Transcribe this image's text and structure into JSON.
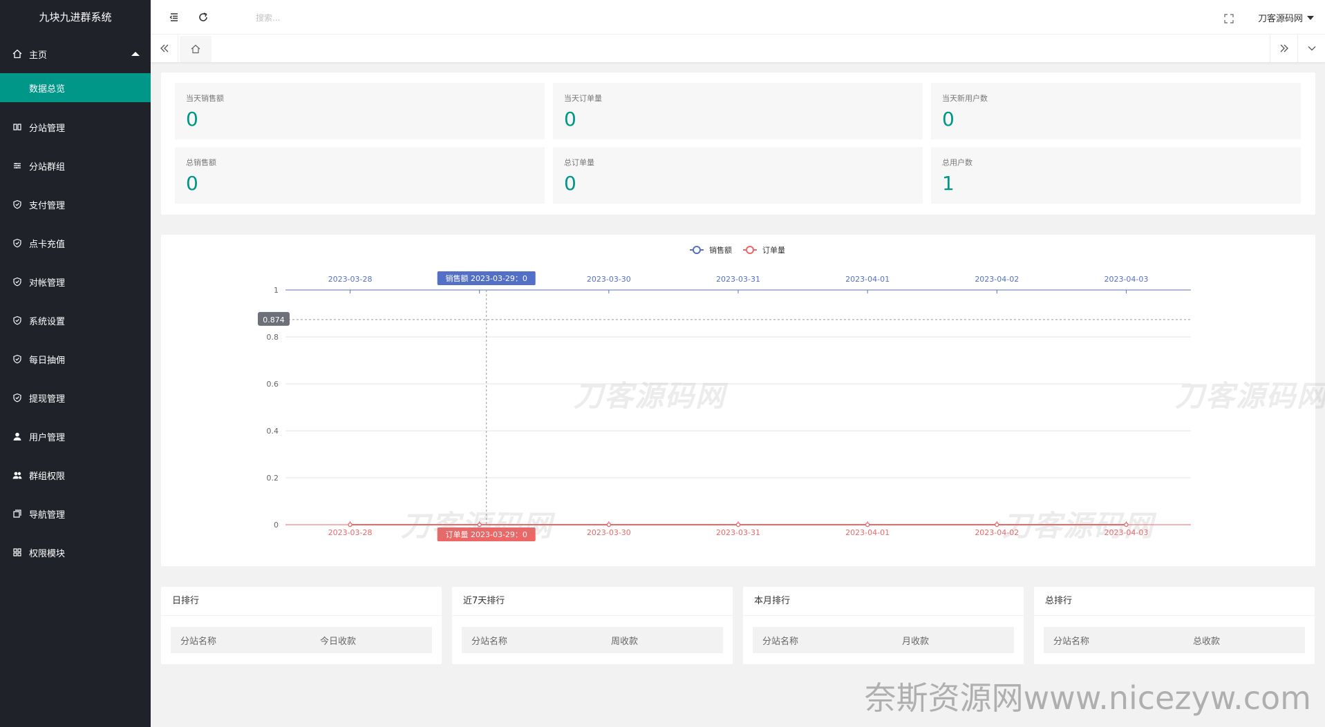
{
  "app": {
    "title": "九块九进群系统"
  },
  "sidebar": {
    "home": {
      "label": "主页",
      "icon": "home-icon"
    },
    "home_sub": {
      "label": "数据总览"
    },
    "items": [
      {
        "label": "分站管理",
        "icon": "columns-icon"
      },
      {
        "label": "分站群组",
        "icon": "sliders-icon"
      },
      {
        "label": "支付管理",
        "icon": "shield-icon"
      },
      {
        "label": "点卡充值",
        "icon": "shield-icon"
      },
      {
        "label": "对帐管理",
        "icon": "shield-icon"
      },
      {
        "label": "系统设置",
        "icon": "shield-icon"
      },
      {
        "label": "每日抽佣",
        "icon": "shield-icon"
      },
      {
        "label": "提现管理",
        "icon": "shield-icon"
      },
      {
        "label": "用户管理",
        "icon": "user-icon"
      },
      {
        "label": "群组权限",
        "icon": "users-icon"
      },
      {
        "label": "导航管理",
        "icon": "nav-icon"
      },
      {
        "label": "权限模块",
        "icon": "modules-icon"
      }
    ]
  },
  "header": {
    "search_placeholder": "搜索...",
    "user_name": "刀客源码网"
  },
  "stats": [
    {
      "label": "当天销售额",
      "value": "0"
    },
    {
      "label": "当天订单量",
      "value": "0"
    },
    {
      "label": "当天新用户数",
      "value": "0"
    },
    {
      "label": "总销售额",
      "value": "0"
    },
    {
      "label": "总订单量",
      "value": "0"
    },
    {
      "label": "总用户数",
      "value": "1"
    }
  ],
  "chart_data": {
    "type": "line",
    "x": [
      "2023-03-28",
      "2023-03-29",
      "2023-03-30",
      "2023-03-31",
      "2023-04-01",
      "2023-04-02",
      "2023-04-03"
    ],
    "series": [
      {
        "name": "销售额",
        "values": [
          0,
          0,
          0,
          0,
          0,
          0,
          0
        ],
        "color": "#5470c6"
      },
      {
        "name": "订单量",
        "values": [
          0,
          0,
          0,
          0,
          0,
          0,
          0
        ],
        "color": "#ee6666"
      }
    ],
    "ylim": [
      0,
      1
    ],
    "yticks": [
      "0",
      "0.2",
      "0.4",
      "0.6",
      "0.8",
      "1"
    ],
    "legend_position": "top-center",
    "grid": true,
    "tooltip": {
      "top_label": "销售额  2023-03-29：0",
      "bottom_label": "订单量  2023-03-29：0",
      "cursor_value": "0.874"
    }
  },
  "rankings": [
    {
      "title": "日排行",
      "col1": "分站名称",
      "col2": "今日收款"
    },
    {
      "title": "近7天排行",
      "col1": "分站名称",
      "col2": "周收款"
    },
    {
      "title": "本月排行",
      "col1": "分站名称",
      "col2": "月收款"
    },
    {
      "title": "总排行",
      "col1": "分站名称",
      "col2": "总收款"
    }
  ],
  "watermarks": {
    "brand": "刀客源码网",
    "site": "奈斯资源网www.nicezyw.com"
  }
}
